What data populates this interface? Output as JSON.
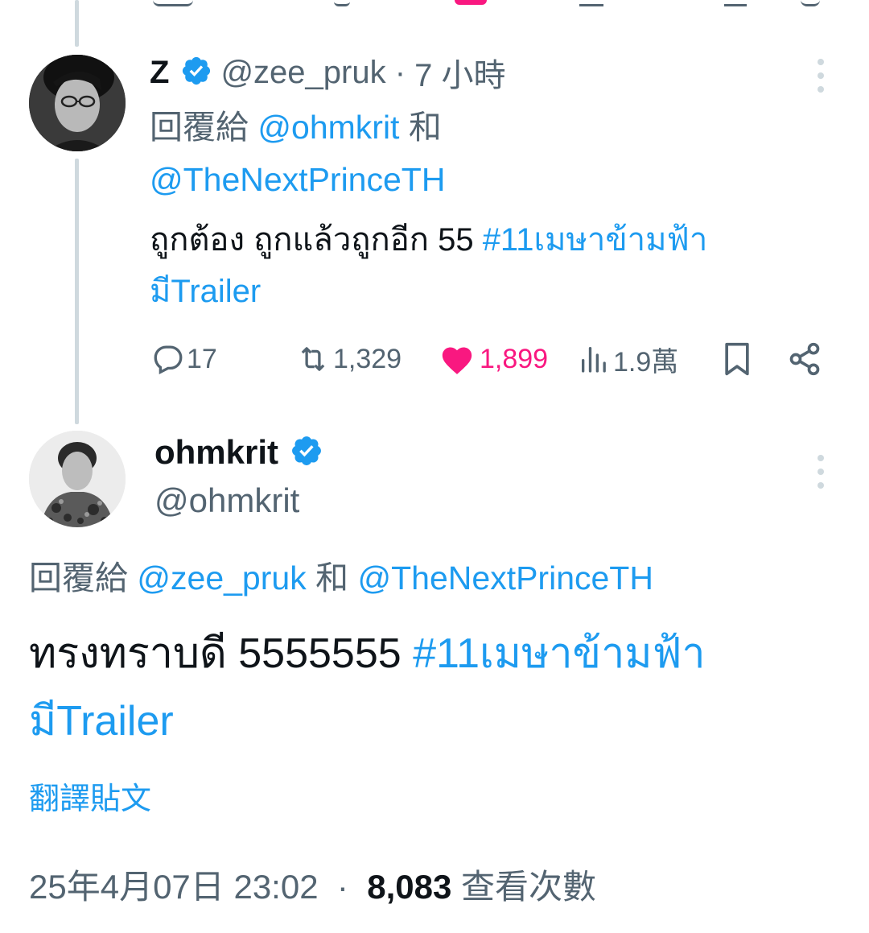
{
  "reply_tweet": {
    "display_name": "Z",
    "handle": "@zee_pruk",
    "time_sep": " · ",
    "time": "7 小時",
    "reply_prefix": "回覆給",
    "reply_mention_1": "@ohmkrit",
    "reply_joiner": "和",
    "reply_mention_2": "@TheNextPrinceTH",
    "text": "ถูกต้อง ถูกแล้วถูกอีก 55",
    "hashtag_line1": "#11เมษาข้ามฟ้า",
    "hashtag_line2": "มีTrailer",
    "stats": {
      "replies": "17",
      "reposts": "1,329",
      "likes": "1,899",
      "views": "1.9萬"
    }
  },
  "main_tweet": {
    "display_name": "ohmkrit",
    "handle": "@ohmkrit",
    "reply_prefix": "回覆給",
    "reply_mention_1": "@zee_pruk",
    "reply_joiner": "和",
    "reply_mention_2": "@TheNextPrinceTH",
    "text": "ทรงทราบดี 5555555",
    "hashtag_line1": "#11เมษาข้ามฟ้า",
    "hashtag_line2": "มีTrailer",
    "translate_label": "翻譯貼文",
    "timestamp": "25年4月07日 23:02",
    "meta_sep": " · ",
    "view_count": "8,083",
    "view_label": "查看次數"
  },
  "colors": {
    "accent": "#1d9bf0",
    "like": "#f91880",
    "muted": "#536471",
    "thread_line": "#cfd9de"
  },
  "icons": [
    "verified-badge-icon",
    "more-icon",
    "reply-icon",
    "repost-icon",
    "like-icon",
    "views-icon",
    "bookmark-icon",
    "share-icon"
  ]
}
